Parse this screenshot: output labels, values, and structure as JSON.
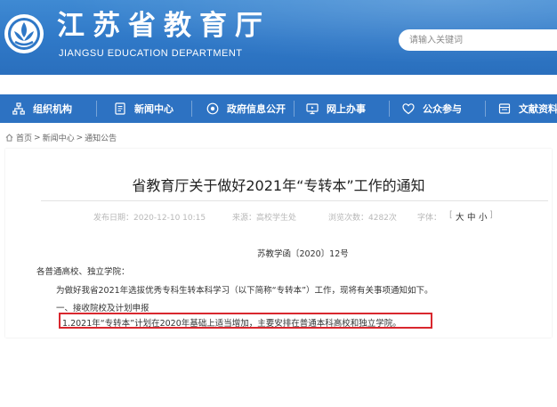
{
  "header": {
    "title": "江苏省教育厅",
    "subtitle": "JIANGSU EDUCATION DEPARTMENT",
    "search_placeholder": "请输入关键词"
  },
  "nav": {
    "items": [
      {
        "label": "组织机构",
        "icon": "org-chart-icon"
      },
      {
        "label": "新闻中心",
        "icon": "document-icon"
      },
      {
        "label": "政府信息公开",
        "icon": "target-icon"
      },
      {
        "label": "网上办事",
        "icon": "monitor-icon"
      },
      {
        "label": "公众参与",
        "icon": "heart-icon"
      },
      {
        "label": "文献资料",
        "icon": "folder-icon"
      }
    ]
  },
  "breadcrumb": {
    "home": "首页",
    "sep1": ">",
    "news": "新闻中心",
    "sep2": ">",
    "current": "通知公告"
  },
  "article": {
    "title": "省教育厅关于做好2021年“专转本”工作的通知",
    "meta": {
      "publish": "发布日期：2020-12-10 10:15",
      "source": "来源：高校学生处",
      "views": "浏览次数：4282次",
      "font_label": "字体：",
      "bracket_open": "[",
      "size_large": "大",
      "size_medium": "中",
      "size_small": "小",
      "bracket_close": "]"
    },
    "doc_number": "苏教学函〔2020〕12号",
    "addressee": "各普通高校、独立学院：",
    "para1": "为做好我省2021年选拔优秀专科生转本科学习（以下简称“专转本”）工作，现将有关事项通知如下。",
    "section1": "一、接收院校及计划申报",
    "item1": "1.2021年“专转本”计划在2020年基础上适当增加，主要安排在普通本科高校和独立学院。"
  },
  "colors": {
    "header_blue": "#2f78c7",
    "nav_blue": "#2d72c2",
    "highlight_red": "#d9272e"
  }
}
